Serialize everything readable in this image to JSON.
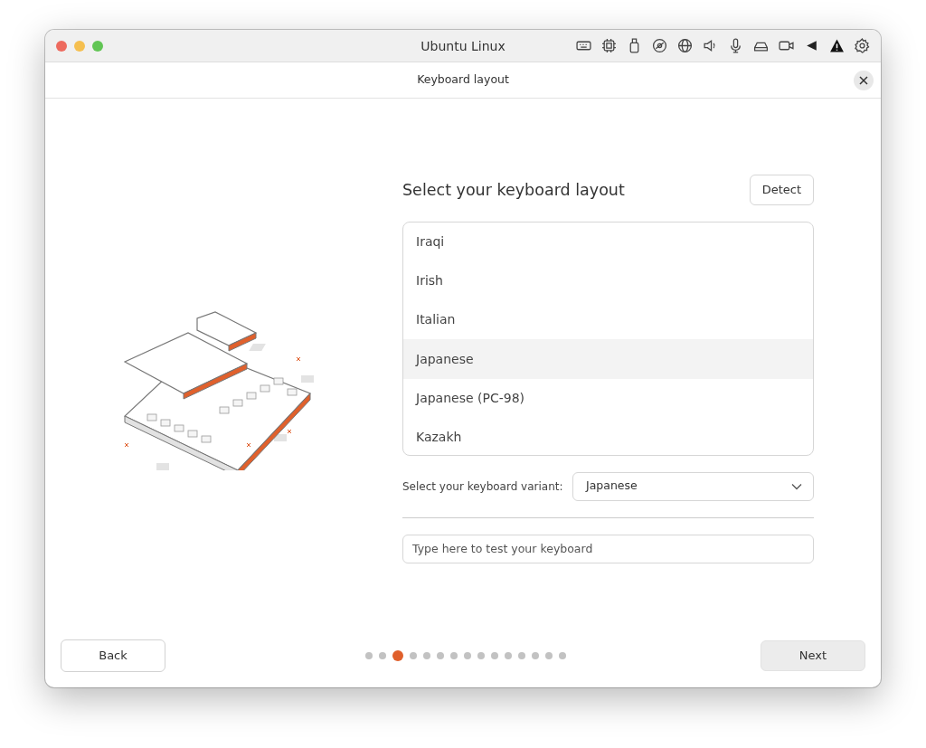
{
  "window": {
    "title": "Ubuntu Linux"
  },
  "dialog": {
    "title": "Keyboard layout"
  },
  "heading": "Select your keyboard layout",
  "detect_button": "Detect",
  "layouts": [
    {
      "label": "Iraqi",
      "selected": false
    },
    {
      "label": "Irish",
      "selected": false
    },
    {
      "label": "Italian",
      "selected": false
    },
    {
      "label": "Japanese",
      "selected": true
    },
    {
      "label": "Japanese (PC-98)",
      "selected": false
    },
    {
      "label": "Kazakh",
      "selected": false
    }
  ],
  "variant": {
    "label": "Select your keyboard variant:",
    "value": "Japanese"
  },
  "test_field": {
    "placeholder": "Type here to test your keyboard"
  },
  "steps": [
    {
      "selected": false
    },
    {
      "selected": false
    },
    {
      "selected": true
    },
    {
      "selected": false
    },
    {
      "selected": false
    },
    {
      "selected": false
    },
    {
      "selected": false
    },
    {
      "selected": false
    },
    {
      "selected": false
    },
    {
      "selected": false
    },
    {
      "selected": false
    },
    {
      "selected": false
    },
    {
      "selected": false
    },
    {
      "selected": false
    },
    {
      "selected": false
    }
  ],
  "back_button": "Back",
  "next_button": "Next"
}
